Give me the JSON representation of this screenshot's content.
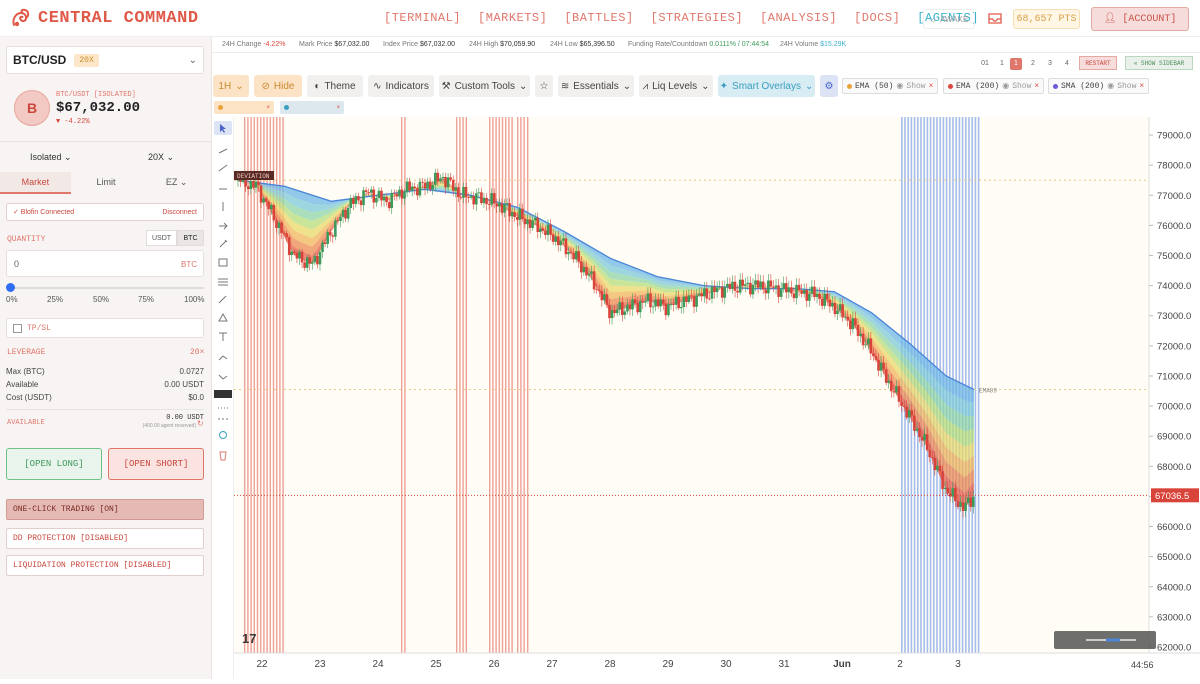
{
  "brand": {
    "name": "CENTRAL COMMAND"
  },
  "nav": {
    "items": [
      "[TERMINAL]",
      "[MARKETS]",
      "[BATTLES]",
      "[STRATEGIES]",
      "[ANALYSIS]",
      "[DOCS]",
      "[AGENTS]"
    ],
    "active": "[AGENTS]"
  },
  "header": {
    "awake_label": "AWAKE",
    "points": "68,657 PTS",
    "account_label": "[ACCOUNT]"
  },
  "sidebar": {
    "pair": "BTC/USD",
    "pair_leverage": "20X",
    "coin_letter": "B",
    "price_sub": "BTC/USDT [ISOLATED]",
    "price": "$67,032.00",
    "change": "▼ -4.22%",
    "margin_mode": "Isolated",
    "leverage_select": "20X",
    "order_tabs": [
      "Market",
      "Limit",
      "EZ"
    ],
    "exchange_status": "✓ Blofin Connected",
    "disconnect": "Disconnect",
    "quantity_label": "QUANTITY",
    "units": [
      "USDT",
      "BTC"
    ],
    "active_unit": "BTC",
    "quantity_value": "0",
    "quantity_unit": "BTC",
    "size_fraction": 0,
    "percent_marks": [
      "0%",
      "25%",
      "50%",
      "75%",
      "100%"
    ],
    "tpsl_label": "TP/SL",
    "leverage_label": "LEVERAGE",
    "leverage_value": "20×",
    "stats": [
      {
        "label": "Max (BTC)",
        "value": "0.0727"
      },
      {
        "label": "Available",
        "value": "0.00 USDT"
      },
      {
        "label": "Cost (USDT)",
        "value": "$0.0"
      }
    ],
    "available_label": "AVAILABLE",
    "available_value": "0.00 USDT",
    "available_note": "(400.00 agent reserved)",
    "open_long": "[OPEN LONG]",
    "open_short": "[OPEN SHORT]",
    "toggles": [
      "ONE-CLICK TRADING [ON]",
      "DD PROTECTION [DISABLED]",
      "LIQUIDATION PROTECTION [DISABLED]"
    ]
  },
  "ticker_stats": [
    {
      "label": "24H Change",
      "value": "-4.22%"
    },
    {
      "label": "Mark Price",
      "value": "$67,032.00"
    },
    {
      "label": "Index Price",
      "value": "$67,032.00"
    },
    {
      "label": "24H High",
      "value": "$70,059.90"
    },
    {
      "label": "24H Low",
      "value": "$65,396.50"
    },
    {
      "label": "Funding Rate/Countdown",
      "value": "0.0111% / 07:44:54"
    },
    {
      "label": "24H Volume",
      "value": "$15.29K"
    }
  ],
  "chart_toolbar": {
    "pages": [
      "01",
      "1",
      "1",
      "2",
      "3",
      "4"
    ],
    "active_page": "1",
    "restart": "RESTART",
    "show_sidebar": "« SHOW SIDEBAR",
    "interval": "1H",
    "hide": "Hide",
    "theme": "Theme",
    "indicators": "Indicators",
    "custom_tools": "Custom Tools",
    "essentials": "Essentials",
    "liq_levels": "Liq Levels",
    "smart_overlays": "Smart Overlays",
    "indicator_chips": [
      {
        "name": "EMA (50)",
        "action": "Show",
        "color": "#e8a23a"
      },
      {
        "name": "EMA (200)",
        "action": "Show",
        "color": "#e0473c"
      },
      {
        "name": "SMA (200)",
        "action": "Show",
        "color": "#6b5bd6"
      }
    ]
  },
  "chart_data": {
    "type": "candlestick",
    "x_tick_labels": [
      "22",
      "23",
      "24",
      "25",
      "26",
      "27",
      "28",
      "29",
      "30",
      "31",
      "Jun",
      "2",
      "3"
    ],
    "y_tick_labels": [
      "79000.0",
      "78000.0",
      "77000.0",
      "76000.0",
      "75000.0",
      "74000.0",
      "73000.0",
      "72000.0",
      "71000.0",
      "70000.0",
      "69000.0",
      "68000.0",
      "67000.0",
      "66000.0",
      "65000.0",
      "64000.0",
      "63000.0",
      "62000.0"
    ],
    "ylim": [
      61800,
      79600
    ],
    "last_price": "67036.5",
    "overlay_labels": {
      "deviation": "DEVIATION",
      "ema": "EMA89"
    },
    "close_path": [
      [
        0,
        77500
      ],
      [
        4,
        77300
      ],
      [
        8,
        76200
      ],
      [
        12,
        75000
      ],
      [
        16,
        74700
      ],
      [
        20,
        75800
      ],
      [
        24,
        76700
      ],
      [
        28,
        77100
      ],
      [
        32,
        76800
      ],
      [
        36,
        77200
      ],
      [
        40,
        77300
      ],
      [
        44,
        77600
      ],
      [
        48,
        77000
      ],
      [
        52,
        76900
      ],
      [
        56,
        76700
      ],
      [
        60,
        76300
      ],
      [
        64,
        76000
      ],
      [
        68,
        75600
      ],
      [
        72,
        75000
      ],
      [
        76,
        74200
      ],
      [
        80,
        73100
      ],
      [
        84,
        73300
      ],
      [
        88,
        73500
      ],
      [
        92,
        73300
      ],
      [
        96,
        73500
      ],
      [
        100,
        73700
      ],
      [
        104,
        73900
      ],
      [
        108,
        74000
      ],
      [
        112,
        74000
      ],
      [
        116,
        73900
      ],
      [
        120,
        73800
      ],
      [
        124,
        73700
      ],
      [
        128,
        73300
      ],
      [
        132,
        72700
      ],
      [
        136,
        71800
      ],
      [
        140,
        70700
      ],
      [
        144,
        69700
      ],
      [
        148,
        68600
      ],
      [
        152,
        67200
      ],
      [
        156,
        66600
      ],
      [
        158,
        67036.5
      ]
    ],
    "ema_path": [
      [
        0,
        77500
      ],
      [
        10,
        77300
      ],
      [
        20,
        76800
      ],
      [
        30,
        77000
      ],
      [
        40,
        77200
      ],
      [
        50,
        77000
      ],
      [
        60,
        76600
      ],
      [
        70,
        75800
      ],
      [
        80,
        74900
      ],
      [
        90,
        74300
      ],
      [
        100,
        74000
      ],
      [
        110,
        73900
      ],
      [
        120,
        73900
      ],
      [
        128,
        73800
      ],
      [
        136,
        73100
      ],
      [
        144,
        72100
      ],
      [
        152,
        71000
      ],
      [
        158,
        70550
      ]
    ],
    "time_index_max": 158,
    "time_label": "44:56"
  }
}
